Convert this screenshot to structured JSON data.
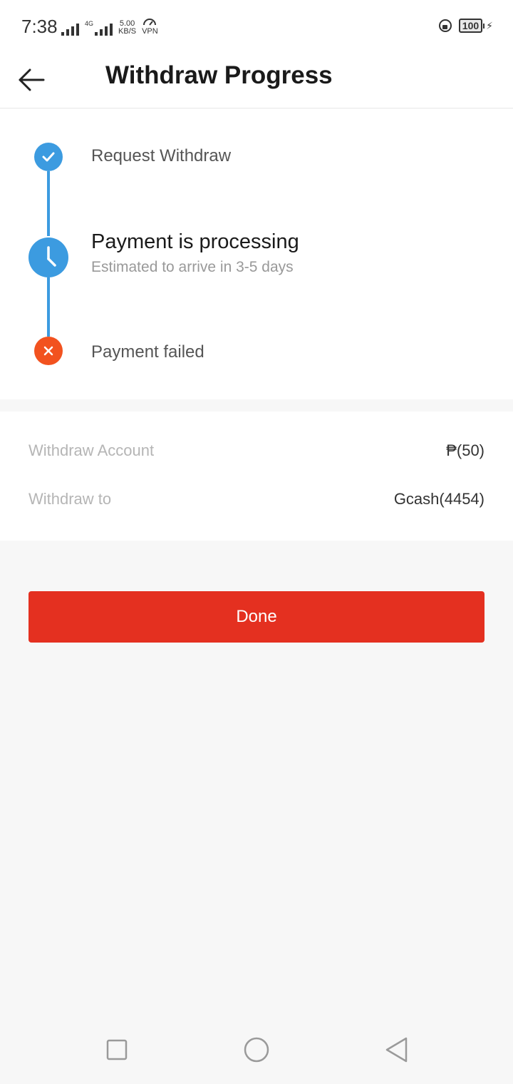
{
  "status_bar": {
    "time": "7:38",
    "network_type": "4G",
    "net_speed_value": "5.00",
    "net_speed_unit": "KB/S",
    "vpn_label": "VPN",
    "battery_level": "100"
  },
  "header": {
    "title": "Withdraw Progress"
  },
  "progress": {
    "steps": [
      {
        "title": "Request Withdraw",
        "subtitle": "",
        "state": "done"
      },
      {
        "title": "Payment is processing",
        "subtitle": "Estimated to arrive in 3-5 days",
        "state": "current"
      },
      {
        "title": "Payment failed",
        "subtitle": "",
        "state": "failed"
      }
    ]
  },
  "details": {
    "rows": [
      {
        "label": "Withdraw Account",
        "value": "₱(50)"
      },
      {
        "label": "Withdraw to",
        "value": "Gcash(4454)"
      }
    ]
  },
  "actions": {
    "done_label": "Done"
  },
  "colors": {
    "accent_blue": "#3c9be0",
    "failed_orange": "#f2521f",
    "button_red": "#e43020"
  }
}
